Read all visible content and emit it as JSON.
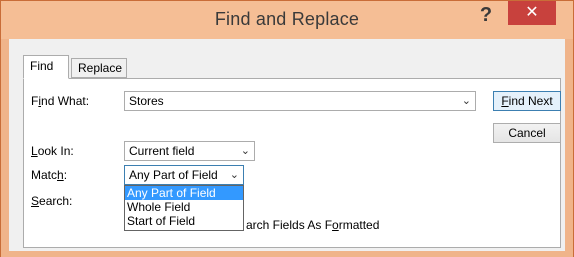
{
  "window": {
    "title": "Find and Replace",
    "help_glyph": "?",
    "close_glyph": "✕"
  },
  "tabs": [
    {
      "label": "Find",
      "active": true
    },
    {
      "label": "Replace",
      "active": false
    }
  ],
  "find_what": {
    "label_pre": "F",
    "label_ul": "i",
    "label_post": "nd What:",
    "value": "Stores"
  },
  "look_in": {
    "label_ul": "L",
    "label_post": "ook In:",
    "value": "Current field"
  },
  "match": {
    "label_pre": "Matc",
    "label_ul": "h",
    "label_post": ":",
    "value": "Any Part of Field",
    "options": [
      "Any Part of Field",
      "Whole Field",
      "Start of Field"
    ],
    "selected_index": 0
  },
  "search": {
    "label_ul": "S",
    "label_post": "earch:"
  },
  "search_fields_formatted": {
    "label_pre": "arch Fields As F",
    "label_ul": "o",
    "label_post": "rmatted"
  },
  "buttons": {
    "find_next_ul": "F",
    "find_next_post": "ind Next",
    "cancel": "Cancel"
  },
  "icons": {
    "dropdown": "chevron-down-icon"
  },
  "colors": {
    "title_bar": "#f5be95",
    "close_button": "#c8413d",
    "selection": "#3399ff"
  }
}
